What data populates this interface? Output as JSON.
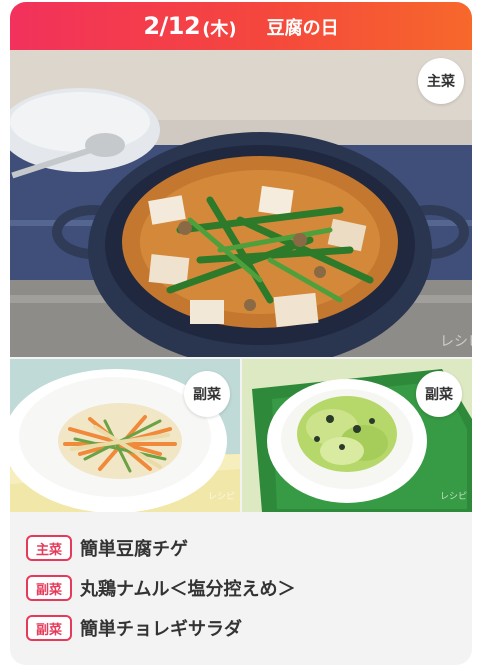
{
  "header": {
    "date": "2/12",
    "day_of_week": "(木)",
    "event": "豆腐の日",
    "gradient_colors": [
      "#f2315c",
      "#f7682b"
    ]
  },
  "photos": [
    {
      "badge": "主菜",
      "icon": "tofu-chige-photo"
    },
    {
      "badge": "副菜",
      "icon": "namul-photo"
    },
    {
      "badge": "副菜",
      "icon": "salad-photo"
    }
  ],
  "recipes": [
    {
      "category": "主菜",
      "name": "簡単豆腐チゲ"
    },
    {
      "category": "副菜",
      "name": "丸鶏ナムル＜塩分控えめ＞"
    },
    {
      "category": "副菜",
      "name": "簡単チョレギサラダ"
    }
  ],
  "colors": {
    "accent": "#e63a5a",
    "card_bg": "#f3f3f3"
  }
}
